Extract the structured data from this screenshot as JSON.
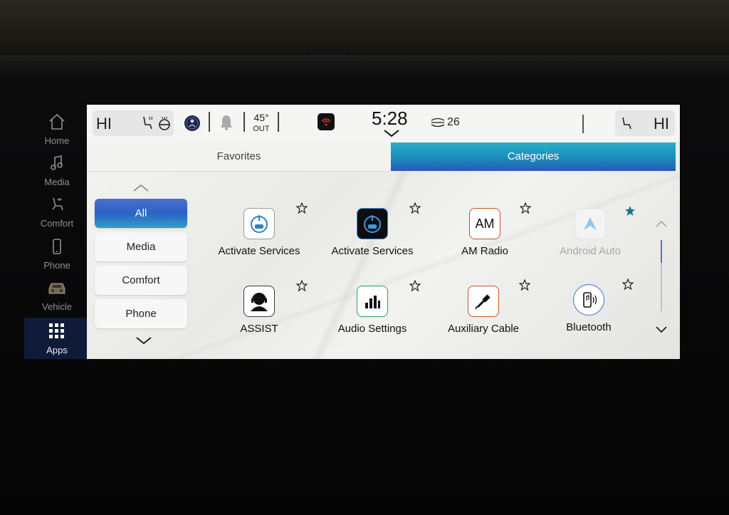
{
  "status": {
    "left_temp": "HI",
    "right_temp": "HI",
    "outside_temp": "45°",
    "outside_label": "OUT",
    "time": "5:28",
    "channel": "26"
  },
  "sidenav": {
    "items": [
      {
        "label": "Home",
        "icon": "home-icon"
      },
      {
        "label": "Media",
        "icon": "music-note-icon"
      },
      {
        "label": "Comfort",
        "icon": "seat-icon"
      },
      {
        "label": "Phone",
        "icon": "phone-icon"
      },
      {
        "label": "Vehicle",
        "icon": "vehicle-icon"
      },
      {
        "label": "Apps",
        "icon": "apps-grid-icon",
        "active": true
      }
    ]
  },
  "tabs": {
    "favorites": "Favorites",
    "categories": "Categories"
  },
  "categories": [
    {
      "label": "All",
      "active": true
    },
    {
      "label": "Media"
    },
    {
      "label": "Comfort"
    },
    {
      "label": "Phone"
    }
  ],
  "apps": [
    {
      "label": "Activate Services",
      "icon": "activate-services-icon",
      "favorite": false
    },
    {
      "label": "Activate Services",
      "icon": "activate-services-dark-icon",
      "favorite": false
    },
    {
      "label": "AM Radio",
      "icon": "am-radio-icon",
      "icon_text": "AM",
      "favorite": false
    },
    {
      "label": "Android Auto",
      "icon": "android-auto-icon",
      "favorite": true,
      "disabled": true
    },
    {
      "label": "ASSIST",
      "icon": "assist-icon",
      "favorite": false
    },
    {
      "label": "Audio Settings",
      "icon": "audio-settings-icon",
      "favorite": false
    },
    {
      "label": "Auxiliary Cable",
      "icon": "auxiliary-cable-icon",
      "favorite": false
    },
    {
      "label": "Bluetooth",
      "icon": "bluetooth-phone-icon",
      "favorite": false
    }
  ],
  "colors": {
    "accent": "#1b88b9",
    "active_nav": "#0f1b38",
    "star_filled": "#1e6f8f"
  }
}
